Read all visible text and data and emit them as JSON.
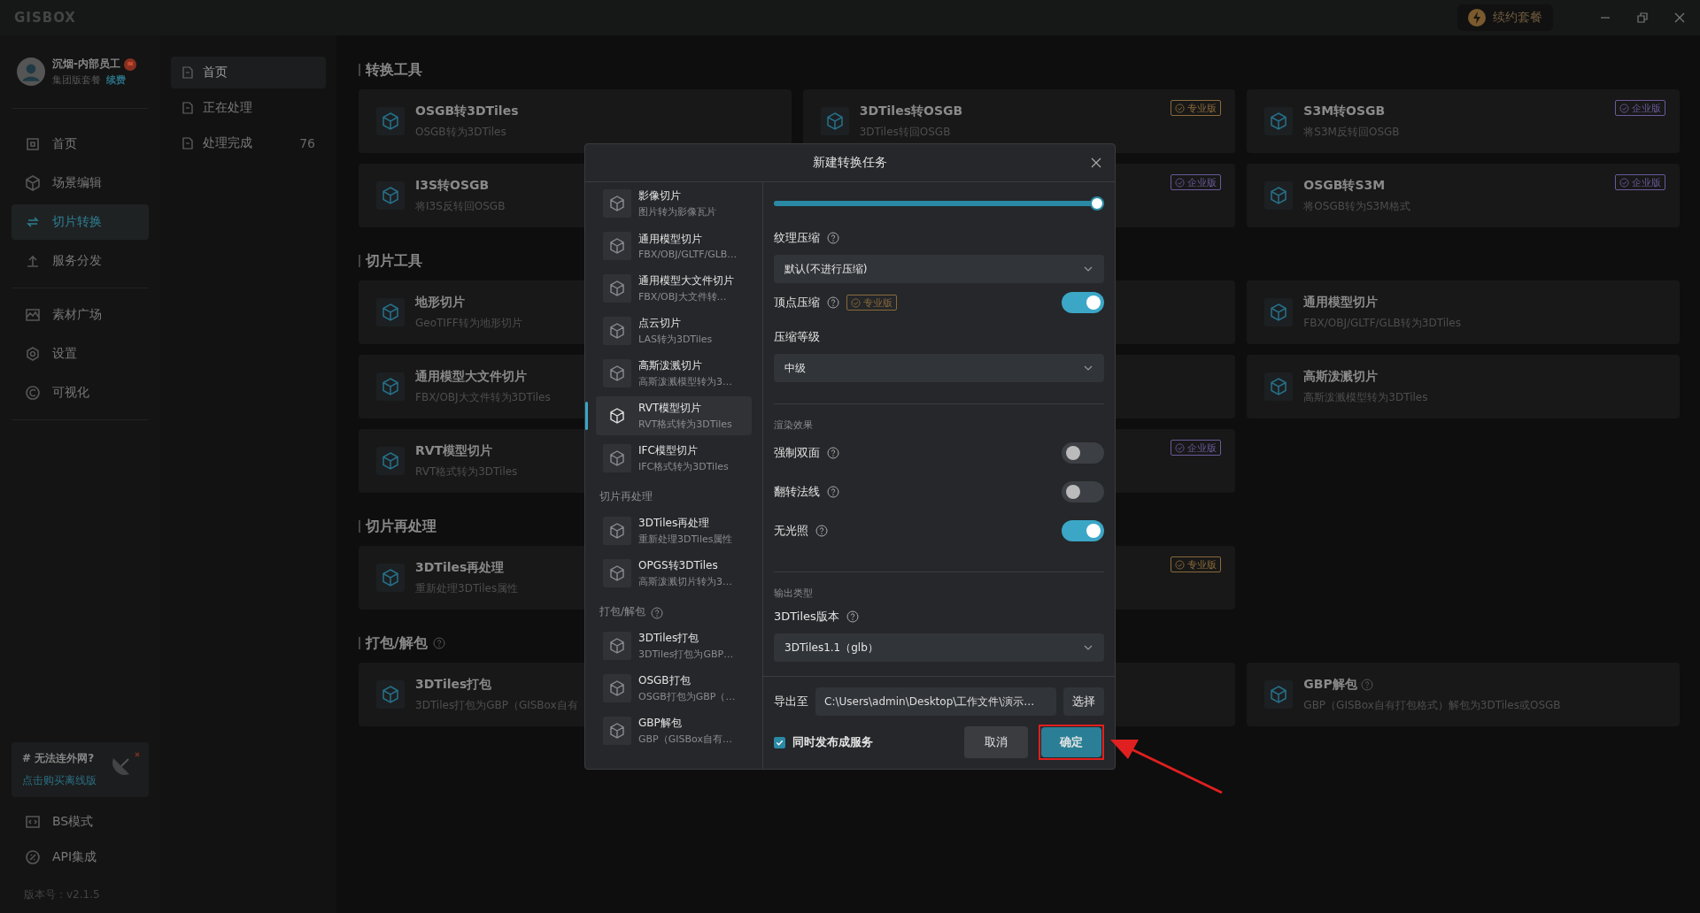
{
  "app": {
    "logo": "GISBOX",
    "renew_button": "续约套餐"
  },
  "user": {
    "name": "沉烟-内部员工",
    "plan": "集团版套餐",
    "renew_link": "续费"
  },
  "nav_groups": [
    [
      {
        "label": "首页",
        "selected": false
      },
      {
        "label": "场景编辑",
        "selected": false
      },
      {
        "label": "切片转换",
        "selected": true
      },
      {
        "label": "服务分发",
        "selected": false
      }
    ],
    [
      {
        "label": "素材广场",
        "selected": false
      },
      {
        "label": "设置",
        "selected": false
      },
      {
        "label": "可视化",
        "selected": false
      }
    ]
  ],
  "promo": {
    "title": "# 无法连外网?",
    "link": "点击购买离线版"
  },
  "bottom_nav": [
    {
      "label": "BS模式",
      "selected": false
    },
    {
      "label": "API集成",
      "selected": false
    }
  ],
  "version": "版本号：v2.1.5",
  "subnav": [
    {
      "label": "首页",
      "selected": true
    },
    {
      "label": "正在处理",
      "selected": false
    },
    {
      "label": "处理完成",
      "count": "76",
      "selected": false
    }
  ],
  "sections": [
    {
      "title": "转换工具",
      "cards": [
        {
          "kind": "tool",
          "title": "OSGB转3DTiles",
          "desc": "OSGB转为3DTiles"
        },
        {
          "kind": "tool",
          "title": "3DTiles转OSGB",
          "desc": "3DTiles转回OSGB",
          "badge": {
            "label": "专业版",
            "kind": "pro"
          }
        },
        {
          "kind": "tool",
          "title": "S3M转OSGB",
          "desc": "将S3M反转回OSGB",
          "badge": {
            "label": "企业版",
            "kind": "enterprise"
          }
        },
        {
          "kind": "tool",
          "title": "I3S转OSGB",
          "desc": "将I3S反转回OSGB"
        },
        {
          "kind": "covered",
          "badge": {
            "label": "企业版",
            "kind": "enterprise"
          }
        },
        {
          "kind": "tool",
          "title": "OSGB转S3M",
          "desc": "将OSGB转为S3M格式",
          "badge": {
            "label": "企业版",
            "kind": "enterprise"
          }
        }
      ]
    },
    {
      "title": "切片工具",
      "cards": [
        {
          "kind": "tool",
          "title": "地形切片",
          "desc": "GeoTIFF转为地形切片"
        },
        {
          "kind": "covered"
        },
        {
          "kind": "tool",
          "title": "通用模型切片",
          "desc": "FBX/OBJ/GLTF/GLB转为3DTiles"
        },
        {
          "kind": "tool",
          "title": "通用模型大文件切片",
          "desc": "FBX/OBJ大文件转为3DTiles"
        },
        {
          "kind": "covered"
        },
        {
          "kind": "tool",
          "title": "高斯泼溅切片",
          "desc": "高斯泼溅模型转为3DTiles"
        },
        {
          "kind": "tool",
          "title": "RVT模型切片",
          "desc": "RVT格式转为3DTiles"
        },
        {
          "kind": "covered",
          "badge": {
            "label": "企业版",
            "kind": "enterprise"
          }
        }
      ]
    },
    {
      "title": "切片再处理",
      "cards": [
        {
          "kind": "tool",
          "title": "3DTiles再处理",
          "desc": "重新处理3DTiles属性"
        },
        {
          "kind": "covered",
          "badge": {
            "label": "专业版",
            "kind": "pro"
          }
        }
      ]
    },
    {
      "title": "打包/解包",
      "help": true,
      "cards": [
        {
          "kind": "tool",
          "title": "3DTiles打包",
          "desc": "3DTiles打包为GBP（GISBox自有"
        },
        {
          "kind": "covered"
        },
        {
          "kind": "tool",
          "title": "GBP解包",
          "help": true,
          "desc": "GBP（GISBox自有打包格式）解包为3DTiles或OSGB"
        }
      ]
    }
  ],
  "dialog": {
    "title": "新建转换任务",
    "items": [
      {
        "kind": "item",
        "title": "影像切片",
        "desc": "图片转为影像瓦片",
        "selected": false
      },
      {
        "kind": "item",
        "title": "通用模型切片",
        "desc": "FBX/OBJ/GLTF/GLB…",
        "selected": false
      },
      {
        "kind": "item",
        "title": "通用模型大文件切片",
        "desc": "FBX/OBJ大文件转…",
        "selected": false
      },
      {
        "kind": "item",
        "title": "点云切片",
        "desc": "LAS转为3DTiles",
        "selected": false
      },
      {
        "kind": "item",
        "title": "高斯泼溅切片",
        "desc": "高斯泼溅模型转为3…",
        "selected": false
      },
      {
        "kind": "item",
        "title": "RVT模型切片",
        "desc": "RVT格式转为3DTiles",
        "selected": true
      },
      {
        "kind": "item",
        "title": "IFC模型切片",
        "desc": "IFC格式转为3DTiles",
        "selected": false
      },
      {
        "kind": "heading",
        "label": "切片再处理"
      },
      {
        "kind": "item",
        "title": "3DTiles再处理",
        "desc": "重新处理3DTiles属性",
        "selected": false
      },
      {
        "kind": "item",
        "title": "OPGS转3DTiles",
        "desc": "高斯泼溅切片转为3…",
        "selected": false
      },
      {
        "kind": "heading",
        "label": "打包/解包",
        "help": true
      },
      {
        "kind": "item",
        "title": "3DTiles打包",
        "desc": "3DTiles打包为GBP…",
        "selected": false
      },
      {
        "kind": "item",
        "title": "OSGB打包",
        "desc": "OSGB打包为GBP（…",
        "selected": false
      },
      {
        "kind": "item",
        "title": "GBP解包",
        "desc": "GBP（GISBox自有…",
        "selected": false
      }
    ],
    "form": [
      {
        "kind": "slider",
        "level": 1
      },
      {
        "kind": "label",
        "label": "纹理压缩",
        "help": true
      },
      {
        "kind": "select",
        "value": "默认(不进行压缩)"
      },
      {
        "kind": "toggle",
        "label": "顶点压缩",
        "help": true,
        "badge": "专业版",
        "on": true
      },
      {
        "kind": "label",
        "label": "压缩等级"
      },
      {
        "kind": "select",
        "value": "中级"
      },
      {
        "kind": "section",
        "label": "渲染效果"
      },
      {
        "kind": "toggle",
        "label": "强制双面",
        "help": true,
        "on": false
      },
      {
        "kind": "toggle",
        "label": "翻转法线",
        "help": true,
        "on": false
      },
      {
        "kind": "toggle",
        "label": "无光照",
        "help": true,
        "on": true
      },
      {
        "kind": "section",
        "label": "输出类型"
      },
      {
        "kind": "label",
        "label": "3DTiles版本",
        "help": true
      },
      {
        "kind": "select",
        "value": "3DTiles1.1（glb）"
      }
    ],
    "footer": {
      "export_label": "导出至",
      "path": "C:\\Users\\admin\\Desktop\\工作文件\\演示…",
      "choose_button": "选择",
      "publish": {
        "label": "同时发布成服务",
        "checked": true
      },
      "cancel": "取消",
      "confirm": "确定"
    }
  }
}
